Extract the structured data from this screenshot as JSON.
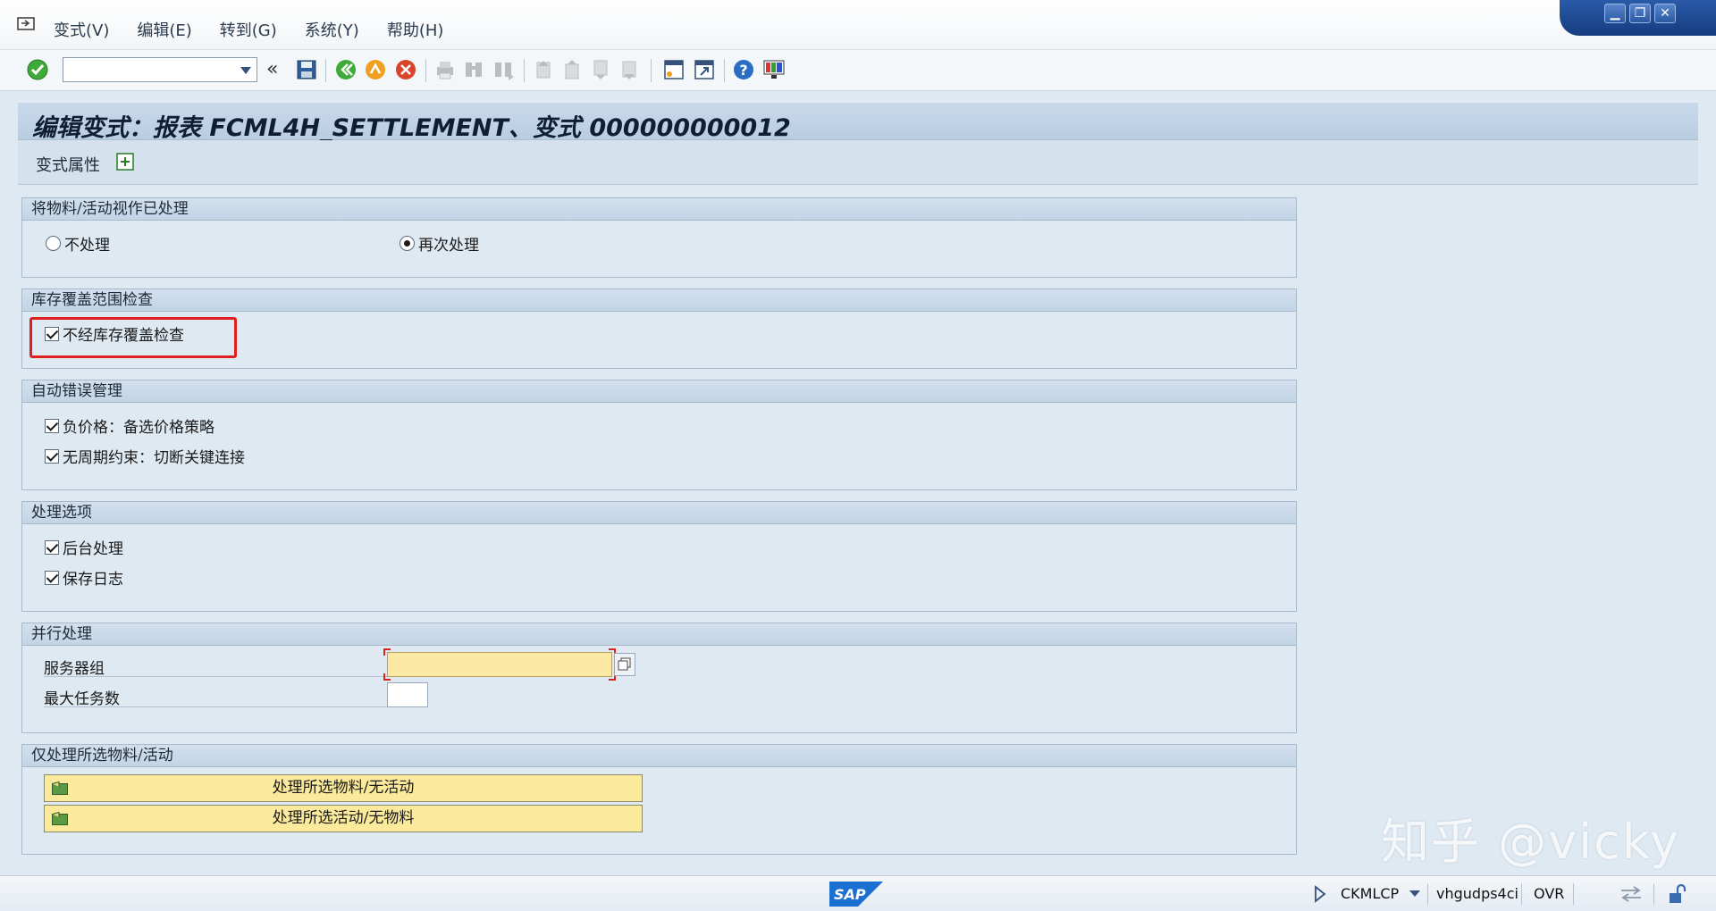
{
  "menu": {
    "items": [
      "变式(V)",
      "编辑(E)",
      "转到(G)",
      "系统(Y)",
      "帮助(H)"
    ]
  },
  "toolbar": {
    "command_value": "",
    "icons": [
      "enter-icon",
      "back-icon",
      "save-icon",
      "back-green-icon",
      "exit-icon",
      "cancel-icon",
      "print-icon",
      "find-icon",
      "find-next-icon",
      "first-page-icon",
      "prev-page-icon",
      "next-page-icon",
      "last-page-icon",
      "create-session-icon",
      "shortcut-icon",
      "help-icon",
      "customize-layout-icon"
    ]
  },
  "title": "编辑变式：报表 FCML4H_SETTLEMENT、变式 000000000012",
  "app_toolbar": {
    "label": "变式属性"
  },
  "groups": {
    "g1": {
      "header": "将物料/活动视作已处理",
      "opt1": "不处理",
      "opt2": "再次处理",
      "selected": "再次处理"
    },
    "g2": {
      "header": "库存覆盖范围检查",
      "cb1": "不经库存覆盖检查"
    },
    "g3": {
      "header": "自动错误管理",
      "cb1": "负价格：备选价格策略",
      "cb2": "无周期约束：切断关键连接"
    },
    "g4": {
      "header": "处理选项",
      "cb1": "后台处理",
      "cb2": "保存日志"
    },
    "g5": {
      "header": "并行处理",
      "field1_label": "服务器组",
      "field1_value": "",
      "field2_label": "最大任务数",
      "field2_value": ""
    },
    "g6": {
      "header": "仅处理所选物料/活动",
      "btn1": "处理所选物料/无活动",
      "btn2": "处理所选活动/无物料"
    }
  },
  "status": {
    "transaction": "CKMLCP",
    "server": "vhgudps4ci",
    "mode": "OVR"
  },
  "watermark": "知乎 @vicky",
  "colors": {
    "required_field": "#fbe9a3",
    "highlight_box": "#e02020",
    "title_bg": "#c9d9ea"
  }
}
